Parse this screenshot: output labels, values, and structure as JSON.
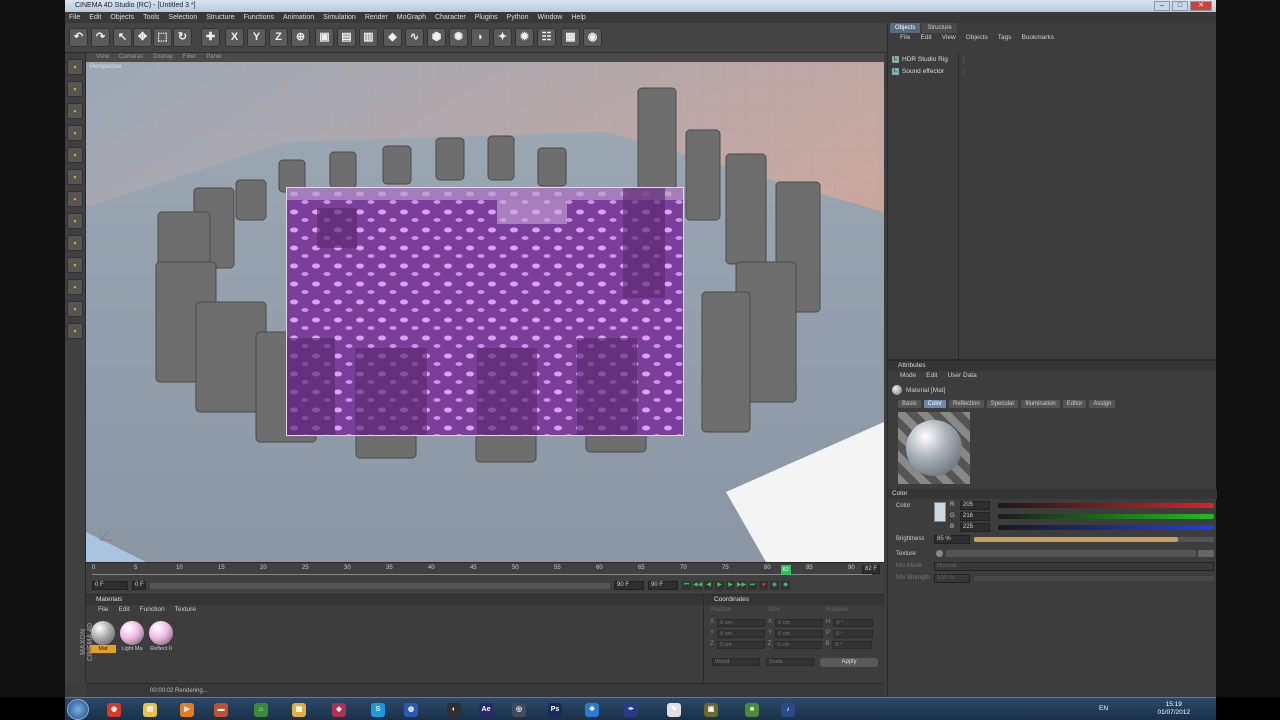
{
  "window": {
    "title": "CINEMA 4D Studio (RC) - [Untitled 3 *]"
  },
  "menubar": [
    "File",
    "Edit",
    "Objects",
    "Tools",
    "Selection",
    "Structure",
    "Functions",
    "Animation",
    "Simulation",
    "Render",
    "MoGraph",
    "Character",
    "Plugins",
    "Python",
    "Window",
    "Help"
  ],
  "viewport": {
    "menu": [
      "View",
      "Cameras",
      "Display",
      "Filter",
      "Panel"
    ],
    "label": "Perspective"
  },
  "timeline": {
    "ticks": [
      "0",
      "5",
      "10",
      "15",
      "20",
      "25",
      "30",
      "35",
      "40",
      "45",
      "50",
      "55",
      "60",
      "65",
      "70",
      "75",
      "80",
      "85",
      "90"
    ],
    "current_frame_badge": "82",
    "end_badge": "82 F",
    "start_field": "0 F",
    "min_field": "0 F",
    "range_end_field": "90 F",
    "max_field": "90 F",
    "playhead_fraction": 0.911
  },
  "materials": {
    "header": "Materials",
    "menu": [
      "File",
      "Edit",
      "Function",
      "Texture"
    ],
    "items": [
      {
        "label": "Mat",
        "color": "#a9a9a9",
        "selected": true
      },
      {
        "label": "Light Ma",
        "color": "#f2b8e6",
        "selected": false
      },
      {
        "label": "Reflect II",
        "color": "#f2b8e6",
        "selected": false
      }
    ]
  },
  "coordinates": {
    "header": "Coordinates",
    "col_headers": [
      "Position",
      "Size",
      "Rotation"
    ],
    "rows": [
      {
        "axis": "X",
        "pos": "0 cm",
        "size": "0 cm",
        "rot_axis": "H",
        "rot": "0 °"
      },
      {
        "axis": "Y",
        "pos": "0 cm",
        "size": "0 cm",
        "rot_axis": "P",
        "rot": "0 °"
      },
      {
        "axis": "Z",
        "pos": "0 cm",
        "size": "0 cm",
        "rot_axis": "B",
        "rot": "0 °"
      }
    ],
    "mode_select": "World",
    "scale_select": "Scale",
    "apply": "Apply"
  },
  "status": {
    "text": "00:00:02 Rendering..."
  },
  "objects_panel": {
    "tabs": [
      "Objects",
      "Structure"
    ],
    "menu": [
      "File",
      "Edit",
      "View",
      "Objects",
      "Tags",
      "Bookmarks"
    ],
    "items": [
      "HDR Studio Rig",
      "Sound effector"
    ]
  },
  "attributes": {
    "header": "Attributes",
    "menu": [
      "Mode",
      "Edit",
      "User Data"
    ],
    "material_name": "Material [Mat]",
    "tabs": [
      "Basic",
      "Color",
      "Reflection",
      "Specular",
      "Illumination",
      "Editor",
      "Assign"
    ],
    "active_tab": "Color",
    "section": "Color",
    "color_label": "Color",
    "r_label": "R",
    "r": "205",
    "g_label": "G",
    "g": "216",
    "b_label": "B",
    "b": "225",
    "brightness_label": "Brightness",
    "brightness": "85 %",
    "brightness_fraction": 0.85,
    "texture_label": "Texture",
    "mix_mode_label": "Mix Mode",
    "mix_mode": "Normal",
    "mix_strength_label": "Mix Strength",
    "mix_strength": "100 %"
  },
  "branding": {
    "maxon": "MAXON",
    "cinema": "CINEMA 4D"
  },
  "taskbar": {
    "lang": "EN",
    "time": "15:19",
    "date": "01/07/2012",
    "apps": [
      {
        "name": "chrome-icon",
        "color": "#d63a2a",
        "glyph": "◉"
      },
      {
        "name": "folder-icon",
        "color": "#e8c050",
        "glyph": "▤"
      },
      {
        "name": "media-player-icon",
        "color": "#e87a20",
        "glyph": "▶"
      },
      {
        "name": "app-icon",
        "color": "#c05030",
        "glyph": "▬"
      },
      {
        "name": "network-icon",
        "color": "#3a8a3a",
        "glyph": "⌂"
      },
      {
        "name": "explorer-icon",
        "color": "#e0b040",
        "glyph": "▦"
      },
      {
        "name": "paint-icon",
        "color": "#b03050",
        "glyph": "◆"
      },
      {
        "name": "skype-icon",
        "color": "#1a9ae0",
        "glyph": "S"
      },
      {
        "name": "firefox-icon",
        "color": "#2a5ab0",
        "glyph": "◍"
      },
      {
        "name": "cinema4d-icon",
        "color": "#303030",
        "glyph": "◐"
      },
      {
        "name": "after-effects-icon",
        "color": "#2a2a6a",
        "glyph": "Ae"
      },
      {
        "name": "steam-icon",
        "color": "#404a5a",
        "glyph": "◎"
      },
      {
        "name": "photoshop-icon",
        "color": "#1a2a5a",
        "glyph": "Ps"
      },
      {
        "name": "dropbox-icon",
        "color": "#2a7ad0",
        "glyph": "❖"
      },
      {
        "name": "ink-icon",
        "color": "#2a3a8a",
        "glyph": "✒"
      },
      {
        "name": "document-icon",
        "color": "#e0e0e0",
        "glyph": "✎"
      },
      {
        "name": "game-icon",
        "color": "#6a6a30",
        "glyph": "▣"
      },
      {
        "name": "minecraft-icon",
        "color": "#4a8a3a",
        "glyph": "■"
      },
      {
        "name": "itunes-icon",
        "color": "#2a4a8a",
        "glyph": "♪"
      }
    ]
  }
}
